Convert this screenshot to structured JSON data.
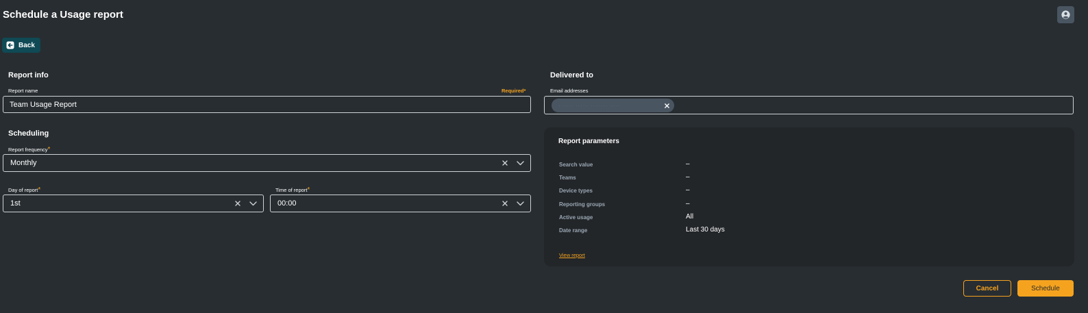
{
  "header": {
    "title": "Schedule a Usage report",
    "user_icon": "user-circle-icon"
  },
  "back": {
    "label": "Back",
    "icon": "arrow-left-box-icon"
  },
  "report_info": {
    "section_title": "Report info",
    "name_label": "Report name",
    "required_label": "Required*",
    "name_value": "Team Usage Report"
  },
  "scheduling": {
    "section_title": "Scheduling",
    "frequency_label": "Report frequency",
    "frequency_value": "Monthly",
    "day_label": "Day of report",
    "day_value": "1st",
    "time_label": "Time of report",
    "time_value": "00:00",
    "required_mark": "*"
  },
  "delivered_to": {
    "section_title": "Delivered to",
    "email_label": "Email addresses",
    "email_chip": "······ ····· ······· ····"
  },
  "report_parameters": {
    "title": "Report parameters",
    "rows": [
      {
        "label": "Search value",
        "value": "–"
      },
      {
        "label": "Teams",
        "value": "–"
      },
      {
        "label": "Device types",
        "value": "–"
      },
      {
        "label": "Reporting groups",
        "value": "–"
      },
      {
        "label": "Active usage",
        "value": "All"
      },
      {
        "label": "Date range",
        "value": "Last 30 days"
      }
    ],
    "view_link": "View report"
  },
  "actions": {
    "cancel": "Cancel",
    "schedule": "Schedule"
  },
  "colors": {
    "background": "#282d31",
    "card": "#232629",
    "accent": "#f5a31f",
    "back_button": "#0f4a55",
    "chip": "#4a5562"
  }
}
